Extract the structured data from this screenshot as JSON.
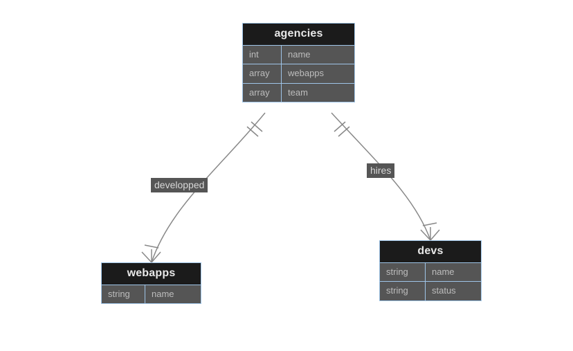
{
  "entities": {
    "agencies": {
      "title": "agencies",
      "rows": [
        {
          "type": "int",
          "name": "name"
        },
        {
          "type": "array",
          "name": "webapps"
        },
        {
          "type": "array",
          "name": "team"
        }
      ]
    },
    "webapps": {
      "title": "webapps",
      "rows": [
        {
          "type": "string",
          "name": "name"
        }
      ]
    },
    "devs": {
      "title": "devs",
      "rows": [
        {
          "type": "string",
          "name": "name"
        },
        {
          "type": "string",
          "name": "status"
        }
      ]
    }
  },
  "relationships": [
    {
      "from": "agencies",
      "to": "webapps",
      "label": "developped",
      "from_cardinality": "exactly-one",
      "to_cardinality": "one-or-many"
    },
    {
      "from": "agencies",
      "to": "devs",
      "label": "hires",
      "from_cardinality": "exactly-one",
      "to_cardinality": "one-or-many"
    }
  ],
  "colors": {
    "border": "#9fc5e8",
    "header_bg": "#1b1b1b",
    "cell_bg": "#555555",
    "line": "#888888"
  }
}
